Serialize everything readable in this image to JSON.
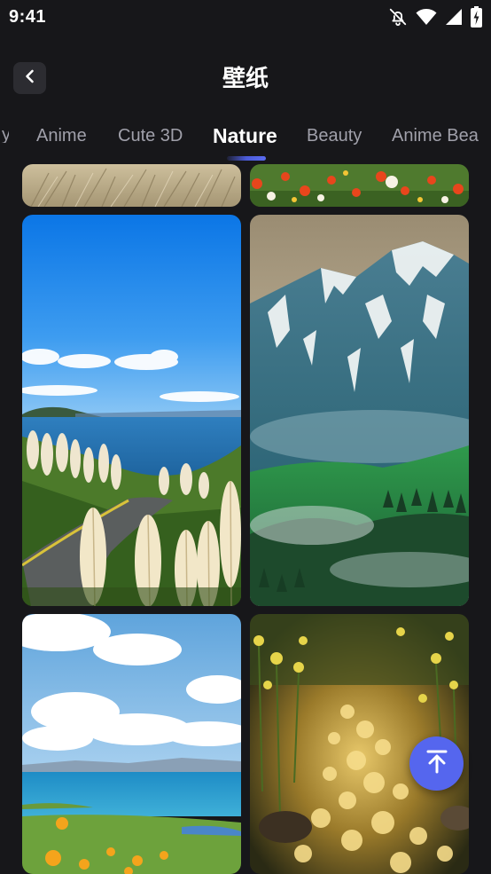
{
  "status_bar": {
    "time": "9:41",
    "icons": [
      "bell-off-icon",
      "wifi-icon",
      "signal-icon",
      "battery-charging-icon"
    ]
  },
  "header": {
    "title": "壁纸",
    "back_icon": "chevron-left-icon"
  },
  "tabs": {
    "items": [
      {
        "label": "Anime"
      },
      {
        "label": "Cute 3D"
      },
      {
        "label": "Nature"
      },
      {
        "label": "Beauty"
      },
      {
        "label": "Anime Bea"
      }
    ],
    "active": "Nature"
  },
  "wallpapers": [
    {
      "name": "dry-grass-wallpaper"
    },
    {
      "name": "flower-meadow-wallpaper"
    },
    {
      "name": "pampas-grass-lake-wallpaper"
    },
    {
      "name": "snowy-mountain-valley-wallpaper"
    },
    {
      "name": "seaside-clouds-wallpaper"
    },
    {
      "name": "golden-stream-flowers-wallpaper"
    }
  ],
  "scroll_top": {
    "icon": "arrow-up-to-top-icon"
  },
  "colors": {
    "background": "#17171a",
    "accent": "#5566ee",
    "tab_inactive": "#a0a0aa",
    "back_button_bg": "#2c2c31"
  }
}
